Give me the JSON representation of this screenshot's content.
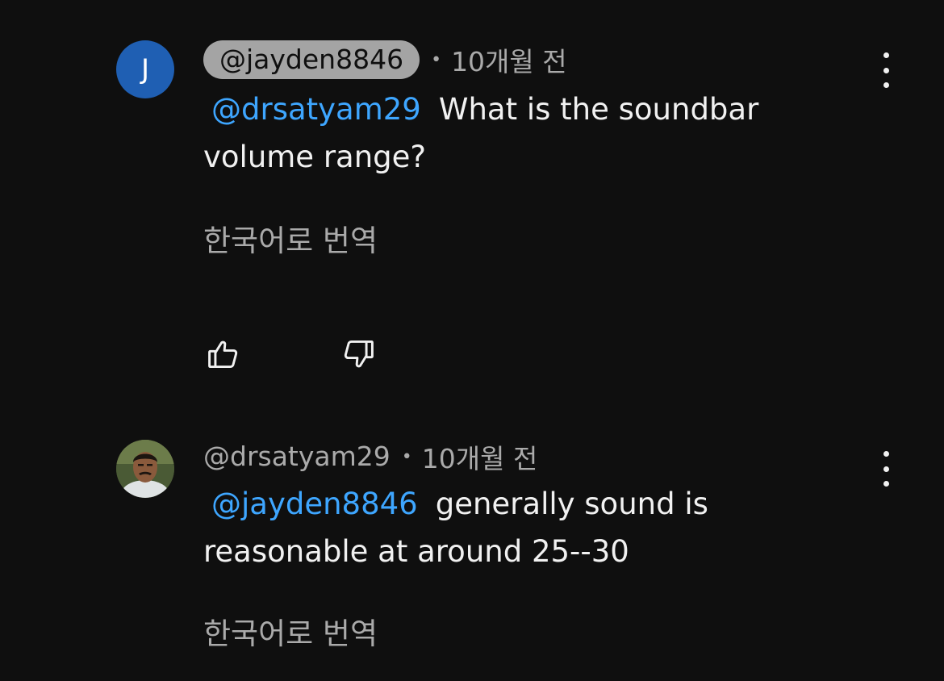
{
  "comments": [
    {
      "author": "@jayden8846",
      "avatar_letter": "J",
      "time_sep": "•",
      "time": "10개월 전",
      "mention": "@drsatyam29",
      "text_line1": "What is the soundbar",
      "text_line2": "volume range?",
      "translate": "한국어로 번역"
    },
    {
      "author": "@drsatyam29",
      "time_sep": "•",
      "time": "10개월 전",
      "mention": "@jayden8846",
      "text_line1": "generally sound is",
      "text_line2": "reasonable at around 25--30",
      "translate": "한국어로 번역"
    }
  ],
  "icons": {
    "like": "thumbs-up-icon",
    "dislike": "thumbs-down-icon",
    "menu": "more-vert-icon"
  },
  "colors": {
    "background": "#0f0f0f",
    "mention": "#3ea6ff",
    "secondary_text": "#aaaaaa",
    "author_chip": "#a4a4a4",
    "avatar_j": "#1f5fb3"
  }
}
